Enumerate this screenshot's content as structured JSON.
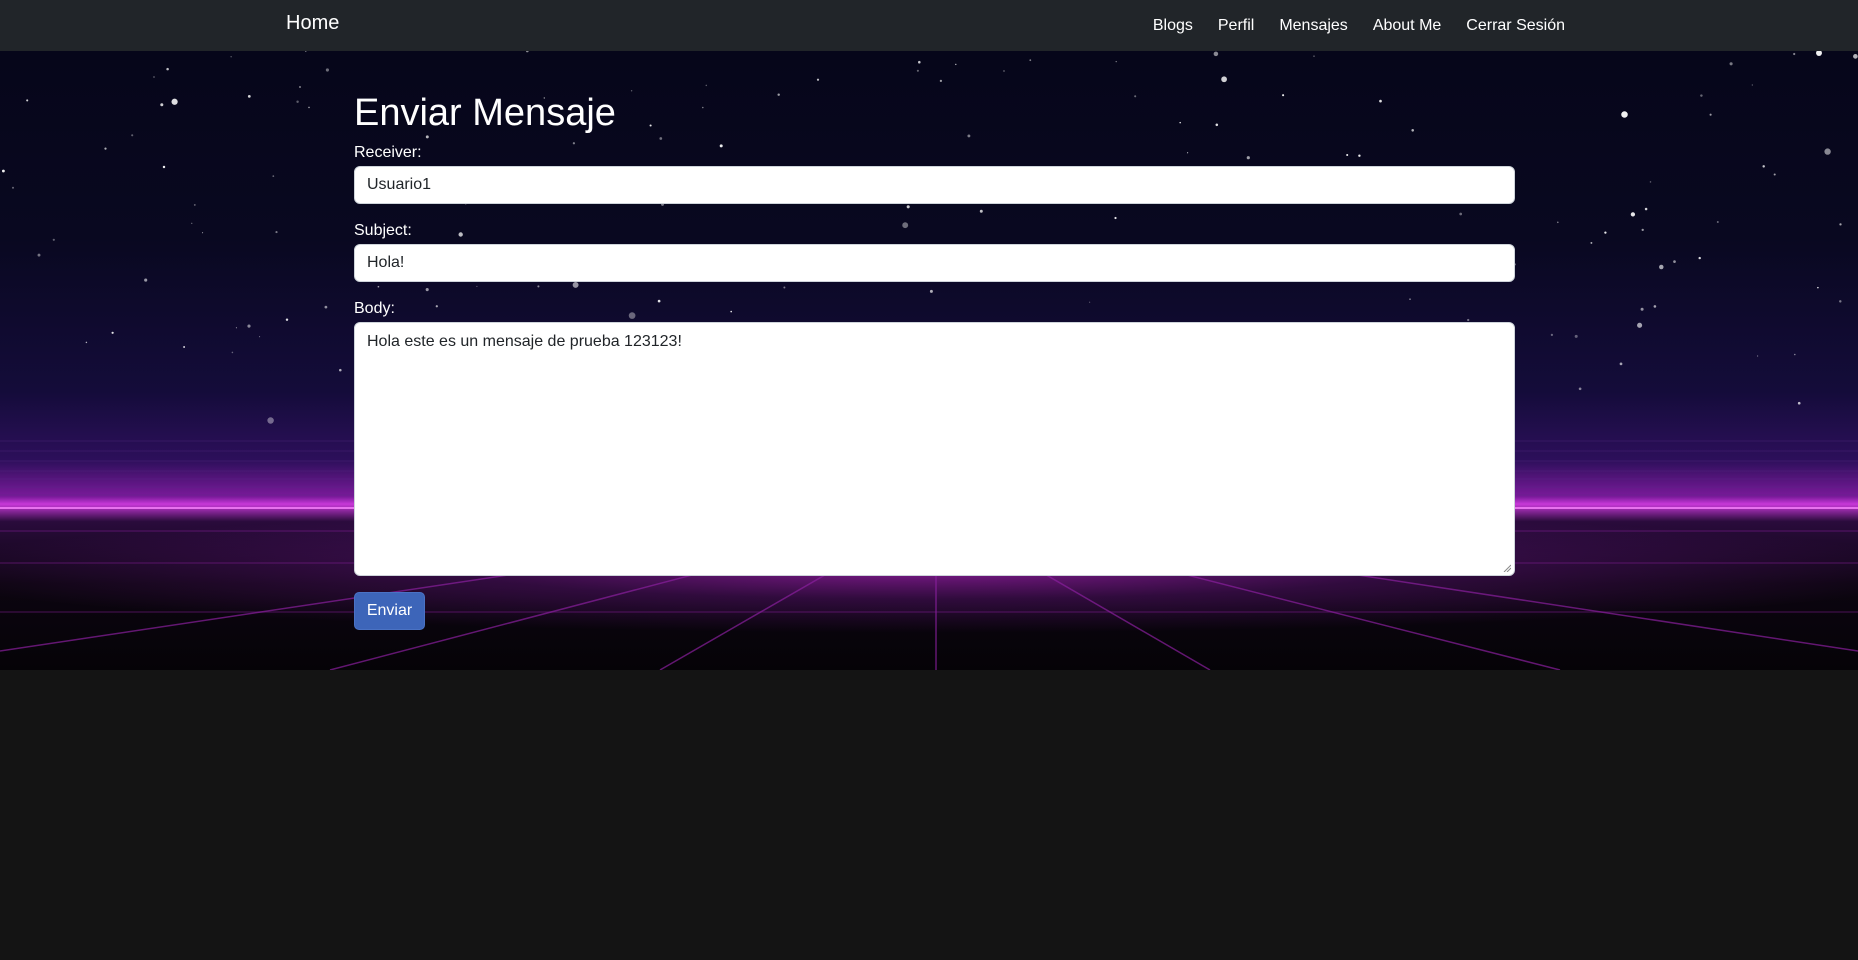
{
  "navbar": {
    "brand": "Home",
    "links": [
      "Blogs",
      "Perfil",
      "Mensajes",
      "About Me",
      "Cerrar Sesión"
    ]
  },
  "form": {
    "title": "Enviar Mensaje",
    "receiver": {
      "label": "Receiver:",
      "value": "Usuario1"
    },
    "subject": {
      "label": "Subject:",
      "value": "Hola!"
    },
    "body": {
      "label": "Body:",
      "value": "Hola este es un mensaje de prueba 123123!"
    },
    "submit_label": "Enviar"
  },
  "colors": {
    "navbar_bg": "#212529",
    "page_bg": "#141414",
    "button_bg": "#3d65b9",
    "horizon_glow": "#c838d8"
  }
}
